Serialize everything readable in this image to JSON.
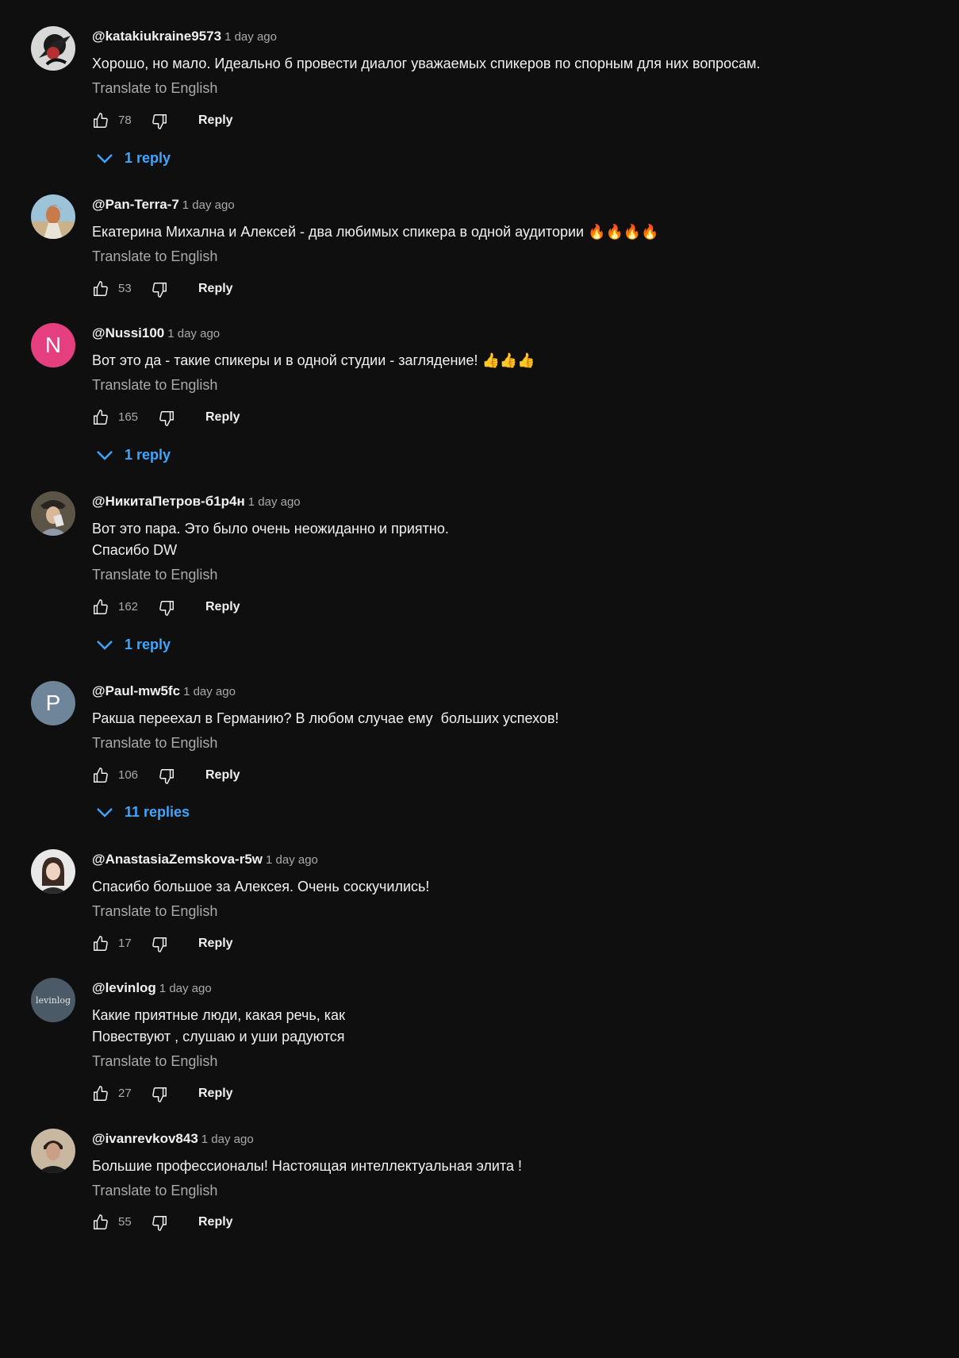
{
  "colors": {
    "background": "#0f0f0f",
    "text": "#f1f1f1",
    "muted": "#aaaaaa",
    "link": "#3ea6ff"
  },
  "comments": [
    {
      "author": "@katakiukraine9573",
      "time": "1 day ago",
      "text": "Хорошо, но мало. Идеально б провести диалог уважаемых спикеров по спорным для них вопросам.",
      "translate": "Translate to English",
      "likes": "78",
      "reply": "Reply",
      "replies": "1 reply",
      "avatar": "photo"
    },
    {
      "author": "@Pan-Terra-7",
      "time": "1 day ago",
      "text": "Екатерина Михална и Алексей - два любимых спикера в одной аудитории 🔥🔥🔥🔥",
      "translate": "Translate to English",
      "likes": "53",
      "reply": "Reply",
      "avatar": "photo"
    },
    {
      "author": "@Nussi100",
      "time": "1 day ago",
      "text": "Вот это да - такие спикеры и в одной студии - заглядение! 👍👍👍",
      "translate": "Translate to English",
      "likes": "165",
      "reply": "Reply",
      "replies": "1 reply",
      "avatar": "N",
      "avatar_color": "#e53f7f"
    },
    {
      "author": "@НикитаПетров-б1р4н",
      "time": "1 day ago",
      "text": "Вот это пара. Это было очень неожиданно и приятно.\nСпасибо DW",
      "translate": "Translate to English",
      "likes": "162",
      "reply": "Reply",
      "replies": "1 reply",
      "avatar": "photo"
    },
    {
      "author": "@Paul-mw5fc",
      "time": "1 day ago",
      "text": "Ракша переехал в Германию? В любом случае ему  больших успехов!",
      "translate": "Translate to English",
      "likes": "106",
      "reply": "Reply",
      "replies": "11 replies",
      "avatar": "P",
      "avatar_color": "#6f8599"
    },
    {
      "author": "@AnastasiaZemskova-r5w",
      "time": "1 day ago",
      "text": "Спасибо большое за Алексея. Очень соскучились!",
      "translate": "Translate to English",
      "likes": "17",
      "reply": "Reply",
      "avatar": "photo"
    },
    {
      "author": "@levinlog",
      "time": "1 day ago",
      "text": "Какие приятные люди, какая речь, как\nПовествуют , слушаю и уши радуются",
      "translate": "Translate to English",
      "likes": "27",
      "reply": "Reply",
      "avatar": "levinlog",
      "avatar_color": "#4a5a66"
    },
    {
      "author": "@ivanrevkov843",
      "time": "1 day ago",
      "text": "Большие профессионалы! Настоящая интеллектуальная элита !",
      "translate": "Translate to English",
      "likes": "55",
      "reply": "Reply",
      "avatar": "photo"
    }
  ]
}
